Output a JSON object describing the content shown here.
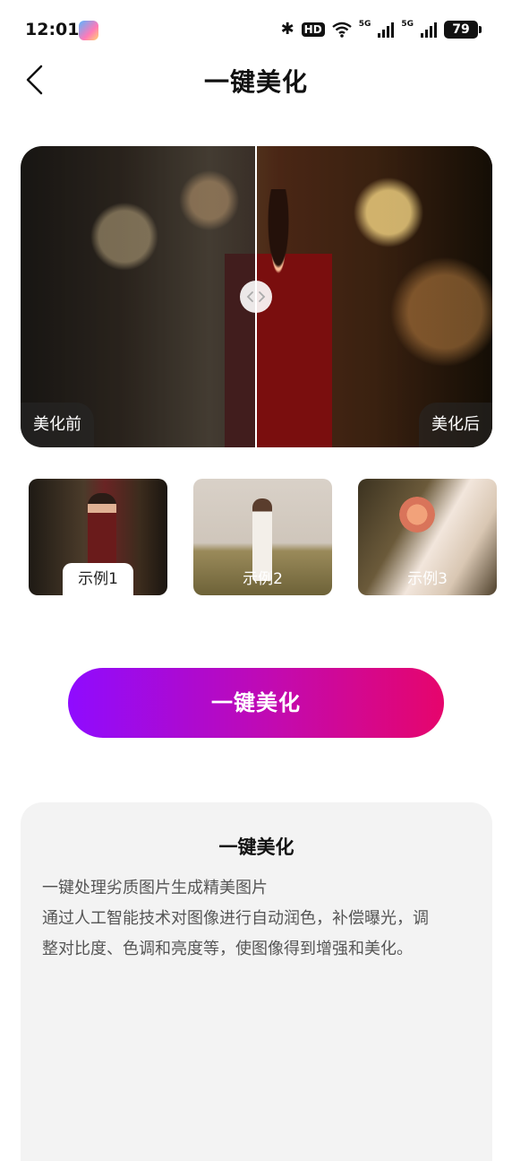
{
  "status_bar": {
    "time": "12:01",
    "hd": "HD",
    "net1": "5G",
    "net2": "5G",
    "battery": "79"
  },
  "header": {
    "title": "一键美化"
  },
  "compare": {
    "before_label": "美化前",
    "after_label": "美化后"
  },
  "examples": [
    {
      "label": "示例1",
      "selected": true
    },
    {
      "label": "示例2",
      "selected": false
    },
    {
      "label": "示例3",
      "selected": false
    }
  ],
  "action": {
    "label": "一键美化",
    "gradient": [
      "#8f0bff",
      "#e6056c"
    ]
  },
  "info": {
    "title": "一键美化",
    "line1": "一键处理劣质图片生成精美图片",
    "line2": "通过人工智能技术对图像进行自动润色，补偿曝光，调",
    "line3": "整对比度、色调和亮度等，使图像得到增强和美化。"
  }
}
